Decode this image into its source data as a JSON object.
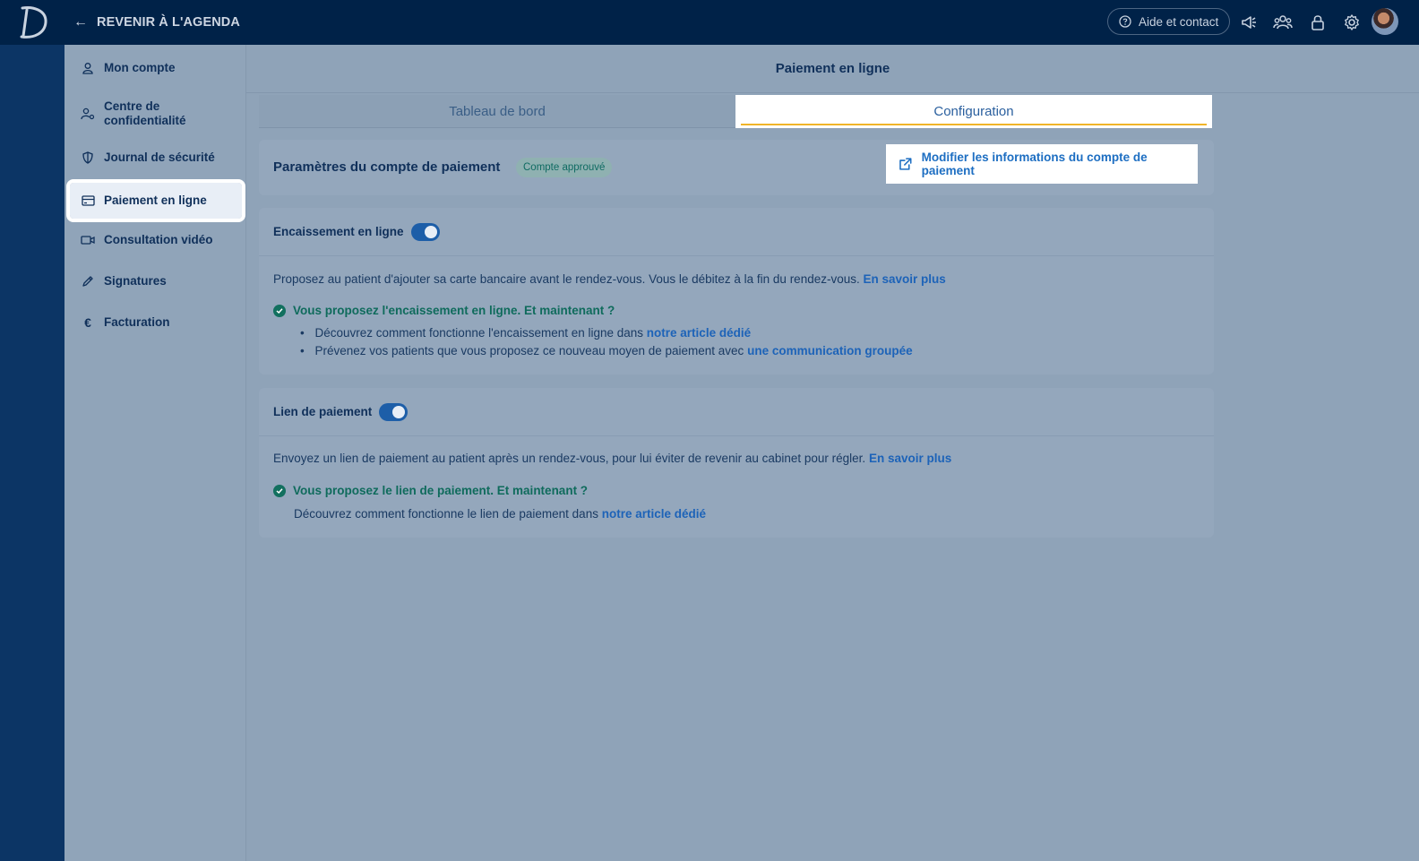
{
  "app": {
    "logo_letter": "D",
    "brand_color": "#002248"
  },
  "topbar": {
    "back_label": "REVENIR À L'AGENDA",
    "help_label": "Aide et contact",
    "icons": [
      "megaphone-icon",
      "team-icon",
      "lock-icon",
      "gear-icon"
    ]
  },
  "sidebar": {
    "items": [
      {
        "label": "Mon compte",
        "icon": "user-icon"
      },
      {
        "label": "Centre de confidentialité",
        "icon": "user-settings-icon"
      },
      {
        "label": "Journal de sécurité",
        "icon": "shield-icon"
      },
      {
        "label": "Paiement en ligne",
        "icon": "credit-card-icon",
        "active": true
      },
      {
        "label": "Consultation vidéo",
        "icon": "video-icon"
      },
      {
        "label": "Signatures",
        "icon": "pen-icon"
      },
      {
        "label": "Facturation",
        "icon": "euro-icon"
      }
    ]
  },
  "main": {
    "title": "Paiement en ligne",
    "tabs": [
      {
        "label": "Tableau de bord",
        "active": false
      },
      {
        "label": "Configuration",
        "active": true
      }
    ],
    "account": {
      "title": "Paramètres du compte de paiement",
      "badge": "Compte approuvé",
      "modify_label": "Modifier les informations du compte de paiement"
    },
    "encaissement": {
      "label": "Encaissement en ligne",
      "enabled": true,
      "description": "Proposez au patient d'ajouter sa carte bancaire avant le rendez-vous. Vous le débitez à la fin du rendez-vous.",
      "learn_more": "En savoir plus",
      "success": "Vous proposez l'encaissement en ligne. Et maintenant ?",
      "bullet1_text": "Découvrez comment fonctionne l'encaissement en ligne dans",
      "bullet1_link": "notre article dédié",
      "bullet2_text": "Prévenez vos patients que vous proposez ce nouveau moyen de paiement avec",
      "bullet2_link": "une communication groupée"
    },
    "lien": {
      "label": "Lien de paiement",
      "enabled": true,
      "description": "Envoyez un lien de paiement au patient après un rendez-vous, pour lui éviter de revenir au cabinet pour régler.",
      "learn_more": "En savoir plus",
      "success": "Vous proposez le lien de paiement. Et maintenant ?",
      "info_text": "Découvrez comment fonctionne le lien de paiement dans",
      "info_link": "notre article dédié"
    }
  }
}
